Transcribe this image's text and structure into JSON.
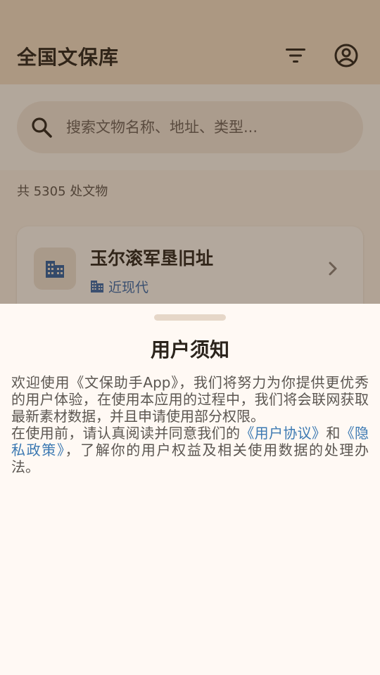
{
  "header": {
    "title": "全国文保库",
    "filter_icon": "filter-list-icon",
    "account_icon": "account-circle-icon"
  },
  "search": {
    "placeholder": "搜索文物名称、地址、类型...",
    "value": ""
  },
  "list": {
    "count_text": "共 5305 处文物",
    "items": [
      {
        "name": "玉尔滚军垦旧址",
        "category": "近现代",
        "icon": "building-icon"
      }
    ]
  },
  "notice": {
    "title": "用户须知",
    "p1": "欢迎使用《文保助手App》，我们将努力为你提供更优秀的用户体验，在使用本应用的过程中，我们将会联网获取最新素材数据，并且申请使用部分权限。",
    "p2_before": "在使用前，请认真阅读并同意我们的",
    "user_agreement": "《用户协议》",
    "p2_and": "和",
    "privacy_policy": "《隐私政策》",
    "p2_after": "，了解你的用户权益及相关使用数据的处理办法。"
  },
  "colors": {
    "app_bar": "#f1dec6",
    "sheet_bg": "#fff9f4",
    "link": "#3c79b2",
    "category": "#3b6aa8"
  }
}
